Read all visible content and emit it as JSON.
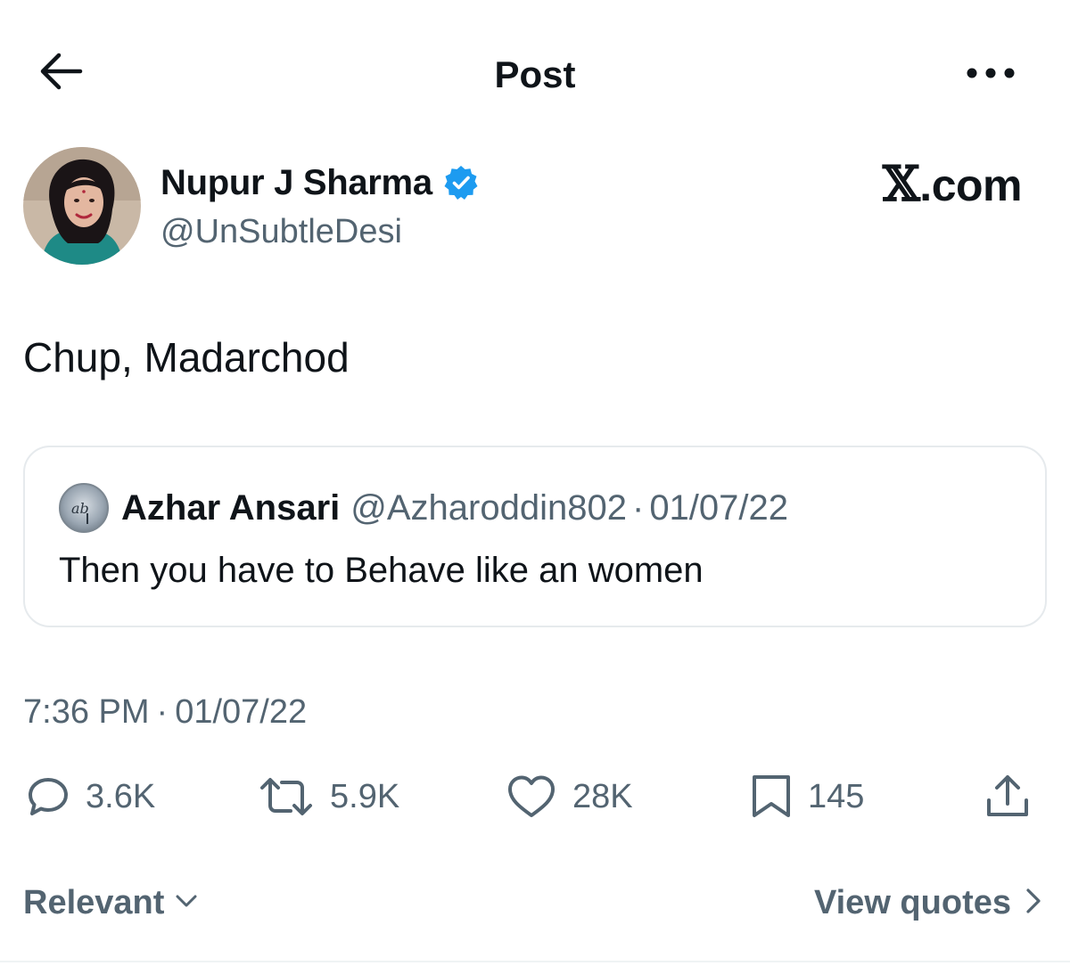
{
  "header": {
    "title": "Post",
    "back_icon": "arrow-left-icon",
    "more_icon": "more-horizontal-icon"
  },
  "author": {
    "name": "Nupur J Sharma",
    "handle": "@UnSubtleDesi",
    "verified_icon": "verified-badge-icon",
    "verified_color": "#1d9bf0"
  },
  "brand": {
    "x": "𝕏",
    "suffix": ".com"
  },
  "post": {
    "text": "Chup, Madarchod"
  },
  "quote": {
    "name": "Azhar Ansari",
    "handle": "@Azharoddin802",
    "separator": "·",
    "date": "01/07/22",
    "text": "Then you have to Behave like an women"
  },
  "meta": {
    "time": "7:36 PM",
    "separator": "·",
    "date": "01/07/22"
  },
  "actions": {
    "reply": {
      "icon": "reply-icon",
      "count": "3.6K"
    },
    "repost": {
      "icon": "repost-icon",
      "count": "5.9K"
    },
    "like": {
      "icon": "heart-icon",
      "count": "28K"
    },
    "bookmark": {
      "icon": "bookmark-icon",
      "count": "145"
    },
    "share": {
      "icon": "share-icon"
    }
  },
  "footer": {
    "sort_label": "Relevant",
    "view_quotes_label": "View quotes"
  },
  "colors": {
    "text": "#0f1419",
    "secondary": "#536471",
    "border": "#e6eaed",
    "accent": "#1d9bf0"
  }
}
